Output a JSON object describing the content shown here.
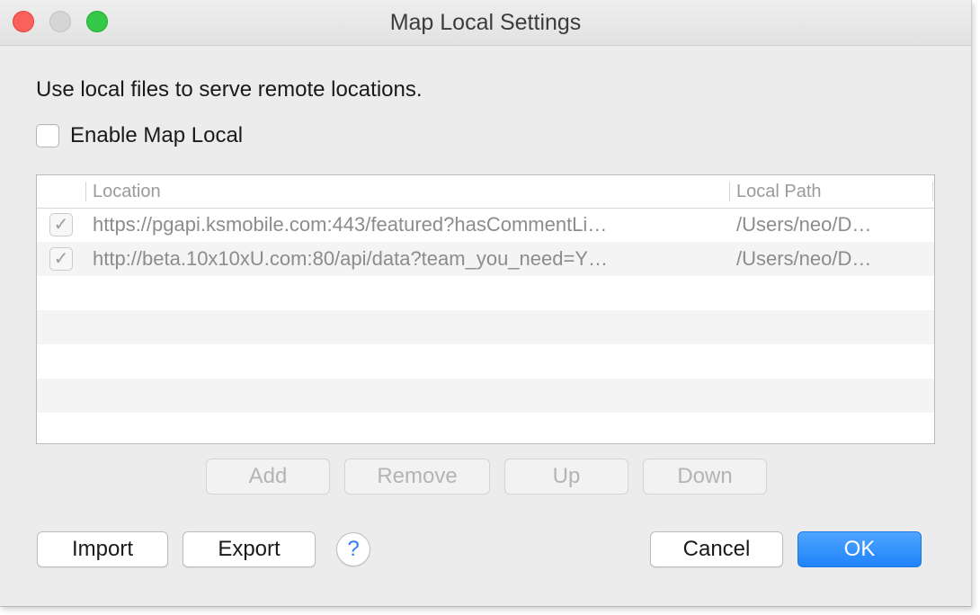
{
  "window": {
    "title": "Map Local Settings"
  },
  "description": "Use local files to serve remote locations.",
  "enable": {
    "label": "Enable Map Local",
    "checked": false
  },
  "table": {
    "columns": {
      "location": "Location",
      "local_path": "Local Path"
    },
    "rows": [
      {
        "enabled": true,
        "check_glyph": "✓",
        "location": "https://pgapi.ksmobile.com:443/featured?hasCommentLi…",
        "local_path": "/Users/neo/D…"
      },
      {
        "enabled": true,
        "check_glyph": "✓",
        "location": "http://beta.10x10xU.com:80/api/data?team_you_need=Y…",
        "local_path": "/Users/neo/D…"
      }
    ]
  },
  "table_buttons": {
    "add": "Add",
    "remove": "Remove",
    "up": "Up",
    "down": "Down"
  },
  "footer": {
    "import": "Import",
    "export": "Export",
    "help": "?",
    "cancel": "Cancel",
    "ok": "OK"
  },
  "colors": {
    "accent": "#1f83fb",
    "close": "#fc605c",
    "minimize": "#d5d5d5",
    "maximize": "#34c748"
  }
}
